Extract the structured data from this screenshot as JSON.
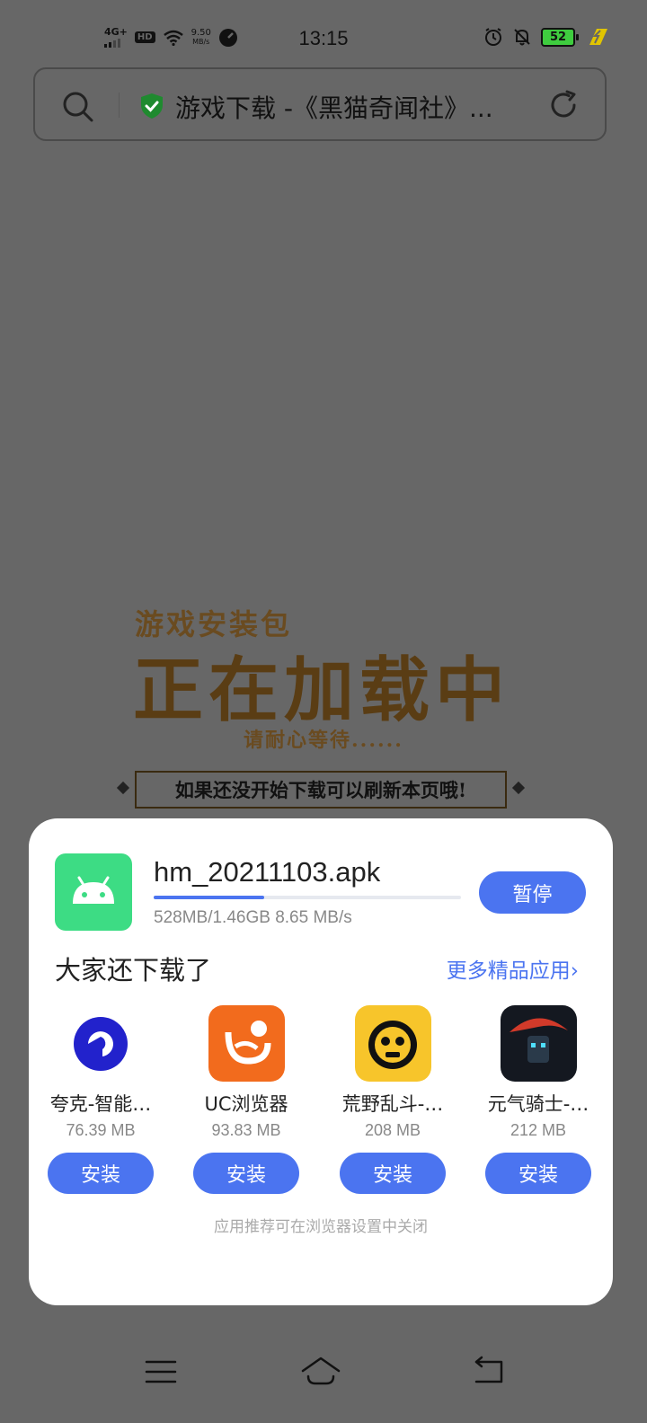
{
  "status_bar": {
    "network": "4G+",
    "hd": "HD",
    "speed_value": "9.50",
    "speed_unit": "MB/s",
    "time": "13:15",
    "battery": "52"
  },
  "address_bar": {
    "title": "游戏下载 -《黑猫奇闻社》..."
  },
  "page": {
    "heading_small": "游戏安装包",
    "heading_big": "正在加载中",
    "wait_text": "请耐心等待......",
    "tip_text": "如果还没开始下载可以刷新本页哦!"
  },
  "download": {
    "file_name": "hm_20211103.apk",
    "progress_fraction": 0.36,
    "info": "528MB/1.46GB  8.65 MB/s",
    "pause_label": "暂停"
  },
  "recommend": {
    "title": "大家还下载了",
    "more_label": "更多精品应用",
    "apps": [
      {
        "name": "夸克-智能…",
        "size": "76.39 MB",
        "install": "安装",
        "icon": "quark-icon"
      },
      {
        "name": "UC浏览器",
        "size": "93.83 MB",
        "install": "安装",
        "icon": "uc-browser-icon"
      },
      {
        "name": "荒野乱斗-…",
        "size": "208 MB",
        "install": "安装",
        "icon": "brawl-stars-icon"
      },
      {
        "name": "元气骑士-…",
        "size": "212 MB",
        "install": "安装",
        "icon": "soul-knight-icon"
      }
    ],
    "footnote": "应用推荐可在浏览器设置中关闭"
  },
  "colors": {
    "accent": "#4b74f0",
    "backdrop": "#676767",
    "android_green": "#3ddc84"
  }
}
